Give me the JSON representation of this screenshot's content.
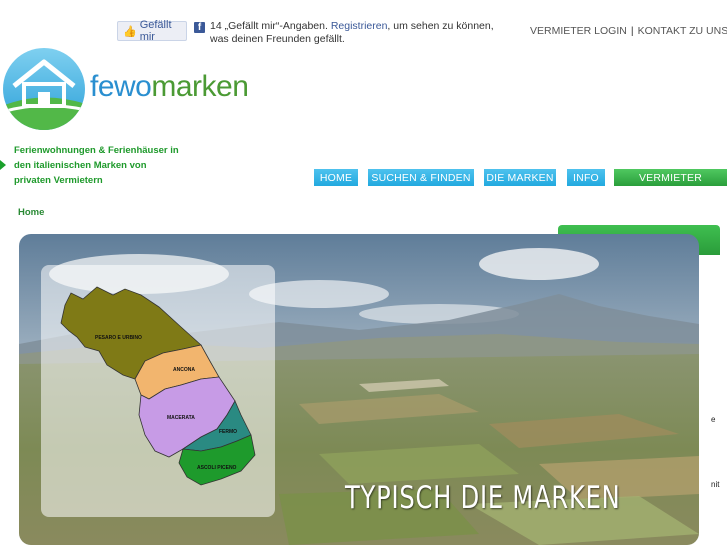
{
  "facebook": {
    "like_label": "Gefällt mir",
    "count_text": "14 „Gefällt mir“-Angaben.",
    "register_link": "Registrieren",
    "rest_text": ", um sehen zu können, was deinen Freunden gefällt.",
    "icon": "facebook-f-icon"
  },
  "top_links": {
    "login": "VERMIETER LOGIN",
    "separator": "|",
    "contact": "KONTAKT ZU UNS"
  },
  "logo": {
    "part1": "fewo",
    "part2": "marken",
    "colors": {
      "fewo": "#2a8fd0",
      "marken": "#4b9a34"
    }
  },
  "tagline": "Ferienwohnungen & Ferienhäuser in den italienischen Marken von privaten Vermietern",
  "nav": [
    {
      "label": "HOME"
    },
    {
      "label": "SUCHEN & FINDEN"
    },
    {
      "label": "DIE MARKEN"
    },
    {
      "label": "INFO"
    },
    {
      "label": "VERMIETER"
    }
  ],
  "breadcrumb": "Home",
  "hero": {
    "caption": "TYPISCH DIE MARKEN",
    "regions": [
      "PESARO E URBINO",
      "ANCONA",
      "MACERATA",
      "FERMO",
      "ASCOLI PICENO"
    ]
  },
  "sidebar": {
    "fragment1": "e",
    "fragment2": "nit"
  },
  "colors": {
    "nav_blue": "#33b5e5",
    "nav_green": "#2a9e3b",
    "tagline_green": "#1f9a2c"
  }
}
